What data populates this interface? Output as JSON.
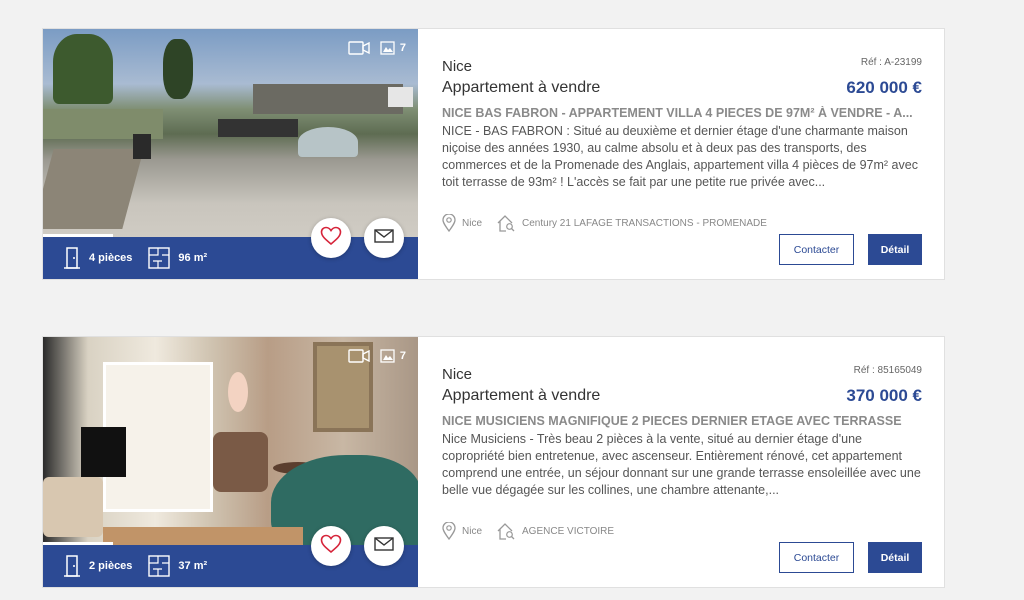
{
  "listings": [
    {
      "city": "Nice",
      "ref": "Réf : A-23199",
      "type": "Appartement à vendre",
      "price": "620 000 €",
      "headline": "NICE BAS FABRON - APPARTEMENT VILLA 4 PIECES DE 97M² À VENDRE - A...",
      "description": "NICE - BAS FABRON : Situé au deuxième et dernier étage d'une charmante maison niçoise des années 1930, au calme absolu et à deux pas des transports, des commerces et de la Promenade des Anglais, appartement villa 4 pièces de 97m² avec toit terrasse de 93m² ! L'accès se fait par une petite rue privée avec...",
      "photo_count": "7",
      "rooms": "4 pièces",
      "surface": "96 m²",
      "location": "Nice",
      "agency": "Century 21 LAFAGE TRANSACTIONS - PROMENADE",
      "contact_label": "Contacter",
      "detail_label": "Détail"
    },
    {
      "city": "Nice",
      "ref": "Réf : 85165049",
      "type": "Appartement à vendre",
      "price": "370 000 €",
      "headline": "NICE MUSICIENS MAGNIFIQUE 2 PIECES DERNIER ETAGE AVEC TERRASSE",
      "description": "Nice Musiciens - Très beau 2 pièces à la vente, situé au dernier étage d'une copropriété bien entretenue, avec ascenseur. Entièrement rénové, cet appartement comprend une entrée, un séjour donnant sur une grande terrasse ensoleillée avec une belle vue dégagée sur les collines, une chambre attenante,...",
      "photo_count": "7",
      "rooms": "2 pièces",
      "surface": "37 m²",
      "location": "Nice",
      "agency": "AGENCE VICTOIRE",
      "contact_label": "Contacter",
      "detail_label": "Détail"
    }
  ],
  "icons": {
    "video": "video-camera-icon",
    "photos": "photo-gallery-icon",
    "rooms": "door-icon",
    "surface": "floor-plan-icon",
    "favorite": "heart-icon",
    "mail": "envelope-icon",
    "location": "map-pin-icon",
    "agency": "house-search-icon"
  },
  "colors": {
    "brand": "#2c4a94",
    "favorite": "#d6243a",
    "background": "#f2f2f2"
  }
}
